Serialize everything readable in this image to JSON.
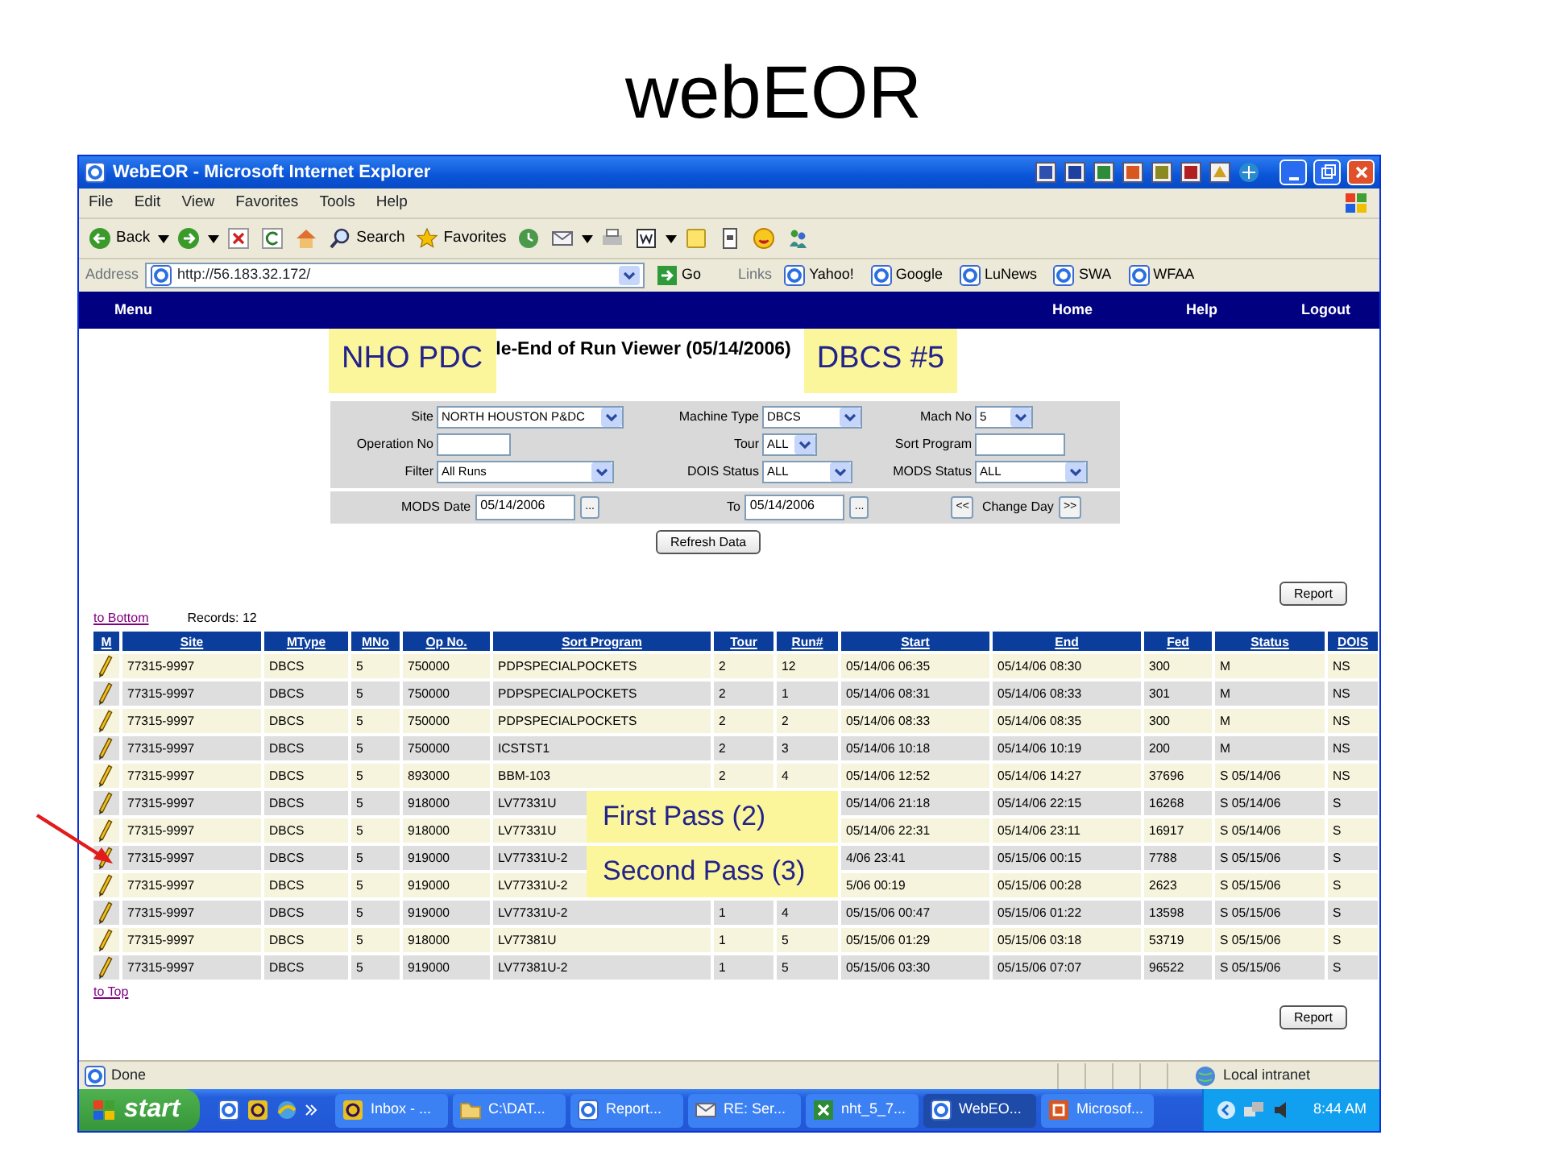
{
  "slide_title": "webEOR",
  "window": {
    "title": "WebEOR - Microsoft Internet Explorer"
  },
  "menu": [
    "File",
    "Edit",
    "View",
    "Favorites",
    "Tools",
    "Help"
  ],
  "toolbar": [
    {
      "kind": "back",
      "label": "Back"
    },
    {
      "kind": "forward"
    },
    {
      "kind": "stop"
    },
    {
      "kind": "refresh"
    },
    {
      "kind": "home"
    },
    {
      "kind": "search",
      "label": "Search"
    },
    {
      "kind": "favorites",
      "label": "Favorites"
    },
    {
      "kind": "history"
    },
    {
      "kind": "mail"
    },
    {
      "kind": "print"
    },
    {
      "kind": "word"
    },
    {
      "kind": "note"
    },
    {
      "kind": "page"
    },
    {
      "kind": "smiley"
    },
    {
      "kind": "messenger"
    }
  ],
  "address": {
    "label": "Address",
    "url": "http://56.183.32.172/",
    "go": "Go"
  },
  "links": {
    "label": "Links",
    "items": [
      "Yahoo!",
      "Google",
      "LuNews",
      "SWA",
      "WFAA"
    ]
  },
  "nav": {
    "left": "Menu",
    "right": [
      "Home",
      "Help",
      "Logout"
    ]
  },
  "header": {
    "callouts": [
      "NHO PDC",
      "DBCS #5"
    ],
    "title": "le-End of Run Viewer (05/14/2006)"
  },
  "filters": [
    [
      {
        "label": "Site",
        "kind": "select",
        "value": "NORTH HOUSTON P&DC"
      },
      {
        "label": "Machine Type",
        "kind": "select",
        "value": "DBCS"
      },
      {
        "label": "Mach No",
        "kind": "select",
        "value": "5"
      }
    ],
    [
      {
        "label": "Operation No",
        "kind": "text"
      },
      {
        "label": "Tour",
        "kind": "select",
        "value": "ALL"
      },
      {
        "label": "Sort Program",
        "kind": "text"
      }
    ],
    [
      {
        "label": "Filter",
        "kind": "select",
        "value": "All Runs"
      },
      {
        "label": "DOIS Status",
        "kind": "select",
        "value": "ALL"
      },
      {
        "label": "MODS Status",
        "kind": "select",
        "value": "ALL"
      }
    ]
  ],
  "dates": {
    "from_label": "MODS Date",
    "from": "05/14/2006",
    "from_picker": "...",
    "to_label": "To",
    "to": "05/14/2006",
    "to_picker": "...",
    "prev": "<<",
    "change": "Change Day",
    "next": ">>"
  },
  "refresh": "Refresh Data",
  "report_top": "Report",
  "to_bottom": "to Bottom",
  "records": "Records: 12",
  "table": {
    "columns": [
      "M",
      "Site",
      "MType",
      "MNo",
      "Op No.",
      "Sort Program",
      "Tour",
      "Run#",
      "Start",
      "End",
      "Fed",
      "Status",
      "DOIS"
    ],
    "rows": [
      {
        "site": "77315-9997",
        "mtype": "DBCS",
        "mno": "5",
        "op": "750000",
        "sort": "PDPSPECIALPOCKETS",
        "tour": "2",
        "run": "12",
        "start": "05/14/06 06:35",
        "end": "05/14/06 08:30",
        "fed": "300",
        "status": "M",
        "dois": "NS"
      },
      {
        "site": "77315-9997",
        "mtype": "DBCS",
        "mno": "5",
        "op": "750000",
        "sort": "PDPSPECIALPOCKETS",
        "tour": "2",
        "run": "1",
        "start": "05/14/06 08:31",
        "end": "05/14/06 08:33",
        "fed": "301",
        "status": "M",
        "dois": "NS"
      },
      {
        "site": "77315-9997",
        "mtype": "DBCS",
        "mno": "5",
        "op": "750000",
        "sort": "PDPSPECIALPOCKETS",
        "tour": "2",
        "run": "2",
        "start": "05/14/06 08:33",
        "end": "05/14/06 08:35",
        "fed": "300",
        "status": "M",
        "dois": "NS"
      },
      {
        "site": "77315-9997",
        "mtype": "DBCS",
        "mno": "5",
        "op": "750000",
        "sort": "ICSTST1",
        "tour": "2",
        "run": "3",
        "start": "05/14/06 10:18",
        "end": "05/14/06 10:19",
        "fed": "200",
        "status": "M",
        "dois": "NS"
      },
      {
        "site": "77315-9997",
        "mtype": "DBCS",
        "mno": "5",
        "op": "893000",
        "sort": "BBM-103",
        "tour": "2",
        "run": "4",
        "start": "05/14/06 12:52",
        "end": "05/14/06 14:27",
        "fed": "37696",
        "status": "S 05/14/06",
        "dois": "NS"
      },
      {
        "site": "77315-9997",
        "mtype": "DBCS",
        "mno": "5",
        "op": "918000",
        "sort": "LV77331U",
        "start": "05/14/06 21:18",
        "end": "05/14/06 22:15",
        "fed": "16268",
        "status": "S 05/14/06",
        "dois": "S"
      },
      {
        "site": "77315-9997",
        "mtype": "DBCS",
        "mno": "5",
        "op": "918000",
        "sort": "LV77331U",
        "start": "05/14/06 22:31",
        "end": "05/14/06 23:11",
        "fed": "16917",
        "status": "S 05/14/06",
        "dois": "S"
      },
      {
        "site": "77315-9997",
        "mtype": "DBCS",
        "mno": "5",
        "op": "919000",
        "sort": "LV77331U-2",
        "start": "4/06 23:41",
        "end": "05/15/06 00:15",
        "fed": "7788",
        "status": "S 05/15/06",
        "dois": "S"
      },
      {
        "site": "77315-9997",
        "mtype": "DBCS",
        "mno": "5",
        "op": "919000",
        "sort": "LV77331U-2",
        "start": "5/06 00:19",
        "end": "05/15/06 00:28",
        "fed": "2623",
        "status": "S 05/15/06",
        "dois": "S"
      },
      {
        "site": "77315-9997",
        "mtype": "DBCS",
        "mno": "5",
        "op": "919000",
        "sort": "LV77331U-2",
        "tour": "1",
        "run": "4",
        "start": "05/15/06 00:47",
        "end": "05/15/06 01:22",
        "fed": "13598",
        "status": "S 05/15/06",
        "dois": "S"
      },
      {
        "site": "77315-9997",
        "mtype": "DBCS",
        "mno": "5",
        "op": "918000",
        "sort": "LV77381U",
        "tour": "1",
        "run": "5",
        "start": "05/15/06 01:29",
        "end": "05/15/06 03:18",
        "fed": "53719",
        "status": "S 05/15/06",
        "dois": "S"
      },
      {
        "site": "77315-9997",
        "mtype": "DBCS",
        "mno": "5",
        "op": "919000",
        "sort": "LV77381U-2",
        "tour": "1",
        "run": "5",
        "start": "05/15/06 03:30",
        "end": "05/15/06 07:07",
        "fed": "96522",
        "status": "S 05/15/06",
        "dois": "S"
      }
    ]
  },
  "table_callouts": [
    {
      "text": "First Pass (2)"
    },
    {
      "text": "Second Pass (3)"
    }
  ],
  "to_top": "to Top",
  "report_bottom": "Report",
  "status_bar": {
    "text": "Done",
    "zone": "Local intranet"
  },
  "taskbar": {
    "start": "start",
    "tasks": [
      {
        "kind": "outlook",
        "label": "Inbox - ...",
        "selected": false
      },
      {
        "kind": "folder",
        "label": "C:\\DAT...",
        "selected": false
      },
      {
        "kind": "ie",
        "label": "Report...",
        "selected": false
      },
      {
        "kind": "mail",
        "label": "RE: Ser...",
        "selected": false
      },
      {
        "kind": "excel",
        "label": "nht_5_7...",
        "selected": false
      },
      {
        "kind": "ie",
        "label": "WebEO...",
        "selected": true
      },
      {
        "kind": "powerpoint",
        "label": "Microsof...",
        "selected": false
      }
    ],
    "time": "8:44 AM"
  }
}
